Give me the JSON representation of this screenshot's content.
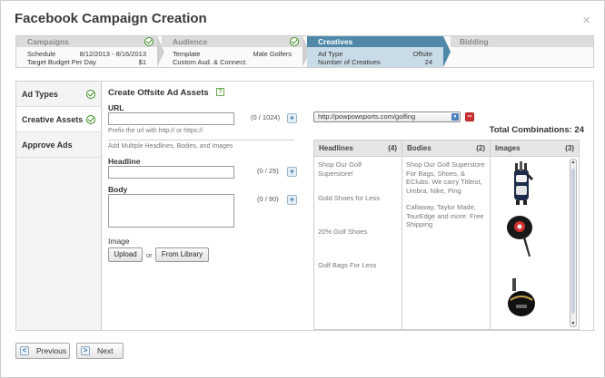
{
  "window": {
    "title": "Facebook Campaign Creation",
    "close_glyph": "×"
  },
  "steps": [
    {
      "label": "Campaigns",
      "rows": [
        [
          "Schedule",
          "8/12/2013 - 8/16/2013"
        ],
        [
          "Target Budget Per Day",
          "$1"
        ]
      ],
      "completed": true
    },
    {
      "label": "Audience",
      "rows": [
        [
          "Template",
          "Male Golfers"
        ],
        [
          "Custom Aud. & Connect.",
          ""
        ]
      ],
      "completed": true
    },
    {
      "label": "Creatives",
      "rows": [
        [
          "Ad Type",
          "Offsite"
        ],
        [
          "Number of Creatives",
          "24"
        ]
      ],
      "active": true
    },
    {
      "label": "Bidding",
      "rows": []
    }
  ],
  "nav": [
    {
      "label": "Ad Types",
      "completed": true
    },
    {
      "label": "Creative Assets",
      "completed": true,
      "active": true
    },
    {
      "label": "Approve Ads",
      "completed": false
    }
  ],
  "form": {
    "section_title": "Create Offsite Ad Assets",
    "help_glyph": "?",
    "url_label": "URL",
    "url_value": "",
    "url_count": "(0 / 1024)",
    "url_hint": "Prefix the url with http:// or https://",
    "multi_hint": "Add Multiple Headlines, Bodies, and Images",
    "headline_label": "Headline",
    "headline_value": "",
    "headline_count": "(0 / 25)",
    "body_label": "Body",
    "body_value": "",
    "body_count": "(0 / 90)",
    "image_label": "Image",
    "upload_label": "Upload",
    "or_text": "or",
    "library_label": "From Library",
    "plus_glyph": "+",
    "minus_glyph": "−"
  },
  "preview": {
    "selected_url": "http://powpowsports.com/golfing",
    "total_label": "Total Combinations: 24",
    "headlines": {
      "title": "Headlines",
      "count": "(4)",
      "items": [
        "Shop Our Golf Superstore!",
        "Gold Shoes for Less",
        "20% Golf Shoes",
        "Golf Bags For Less"
      ]
    },
    "bodies": {
      "title": "Bodies",
      "count": "(2)",
      "items": [
        "Shop Our Golf Superstore For Bags, Shoes, & EClubs. We carry Titleist, Umbra, Nike, Ping",
        "Callaway, Taylor Made, TourEdge and more. Free Shipping"
      ]
    },
    "images": {
      "title": "Images",
      "count": "(3)",
      "items": [
        "golf-bag-image",
        "red-driver-image",
        "black-driver-image"
      ]
    }
  },
  "footer": {
    "previous_label": "Previous",
    "next_label": "Next",
    "prev_glyph": "<",
    "next_glyph": ">"
  },
  "colors": {
    "accent": "#4f88a8",
    "accent_light": "#c9dbe6",
    "check_green": "#3c8c20",
    "remove_red": "#cc3333"
  }
}
